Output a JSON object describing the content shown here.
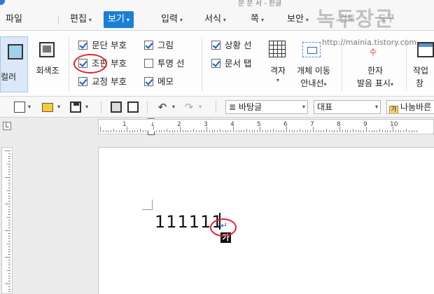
{
  "titlebar": {
    "title": "문 문 서 - 한글"
  },
  "menu": {
    "items": [
      {
        "label": "파일",
        "arrow": false
      },
      {
        "label": "편집",
        "arrow": true
      },
      {
        "label": "보기",
        "arrow": true,
        "active": true
      },
      {
        "label": "입력",
        "arrow": true
      },
      {
        "label": "서식",
        "arrow": true
      },
      {
        "label": "쪽",
        "arrow": true
      },
      {
        "label": "보안",
        "arrow": true
      },
      {
        "label": "검토",
        "arrow": false
      },
      {
        "label": "도구",
        "arrow": false
      }
    ],
    "arrow_glyph": "▾"
  },
  "watermark": {
    "title": "녹두장군",
    "url": "http://mainia.tistory.com"
  },
  "ribbon": {
    "color_button": "컬러",
    "gray_button": "회색조",
    "checkboxes": [
      {
        "label": "문단 부호",
        "checked": true
      },
      {
        "label": "조판 부호",
        "checked": true
      },
      {
        "label": "교정 부호",
        "checked": true
      },
      {
        "label": "그림",
        "checked": true
      },
      {
        "label": "투명 선",
        "checked": false
      },
      {
        "label": "메모",
        "checked": true
      },
      {
        "label": "상황 선",
        "checked": true
      },
      {
        "label": "문서 탭",
        "checked": true
      }
    ],
    "grid": "격자",
    "guide_line": [
      "개체 이동",
      "안내선"
    ],
    "hanja_icon": "漢\n수",
    "hanja": [
      "한자",
      "발음 표시"
    ],
    "work_window": [
      "작업",
      "창"
    ]
  },
  "toolbar": {
    "style_value": "바탕글",
    "style_lead": "≣",
    "font_group_value": "대표",
    "font_value": "나눔바른",
    "font_glyph": "가",
    "undo_glyph": "↶",
    "redo_glyph": "↷"
  },
  "ruler": {
    "corner_glyph": "L",
    "numbers": [
      "1",
      "1",
      "2",
      "3",
      "4",
      "5",
      "6",
      "7",
      "8",
      "9",
      "10"
    ]
  },
  "document": {
    "text": "111111",
    "para_mark": "↵",
    "ime_indicator": "가"
  },
  "annotations": {
    "highlight_color": "#e0222d"
  },
  "colors": {
    "accent": "#1c7fd3",
    "checkmark": "#1a5fb4",
    "paragraph_mark": "#2d66c3"
  }
}
